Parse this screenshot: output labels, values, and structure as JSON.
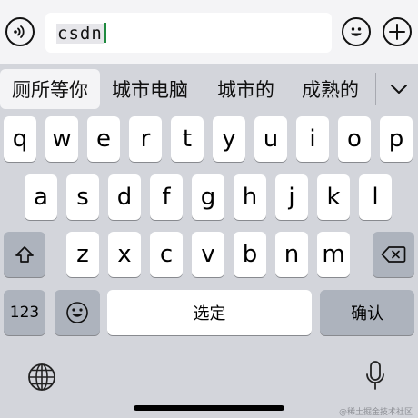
{
  "input_bar": {
    "typed_text": "csdn"
  },
  "candidates": [
    "厕所等你",
    "城市电脑",
    "城市的",
    "成熟的"
  ],
  "keyboard": {
    "row1": [
      "q",
      "w",
      "e",
      "r",
      "t",
      "y",
      "u",
      "i",
      "o",
      "p"
    ],
    "row2": [
      "a",
      "s",
      "d",
      "f",
      "g",
      "h",
      "j",
      "k",
      "l"
    ],
    "row3": [
      "z",
      "x",
      "c",
      "v",
      "b",
      "n",
      "m"
    ],
    "numbers_key": "123",
    "space_key": "选定",
    "confirm_key": "确认"
  },
  "watermark": "@稀土掘金技术社区"
}
